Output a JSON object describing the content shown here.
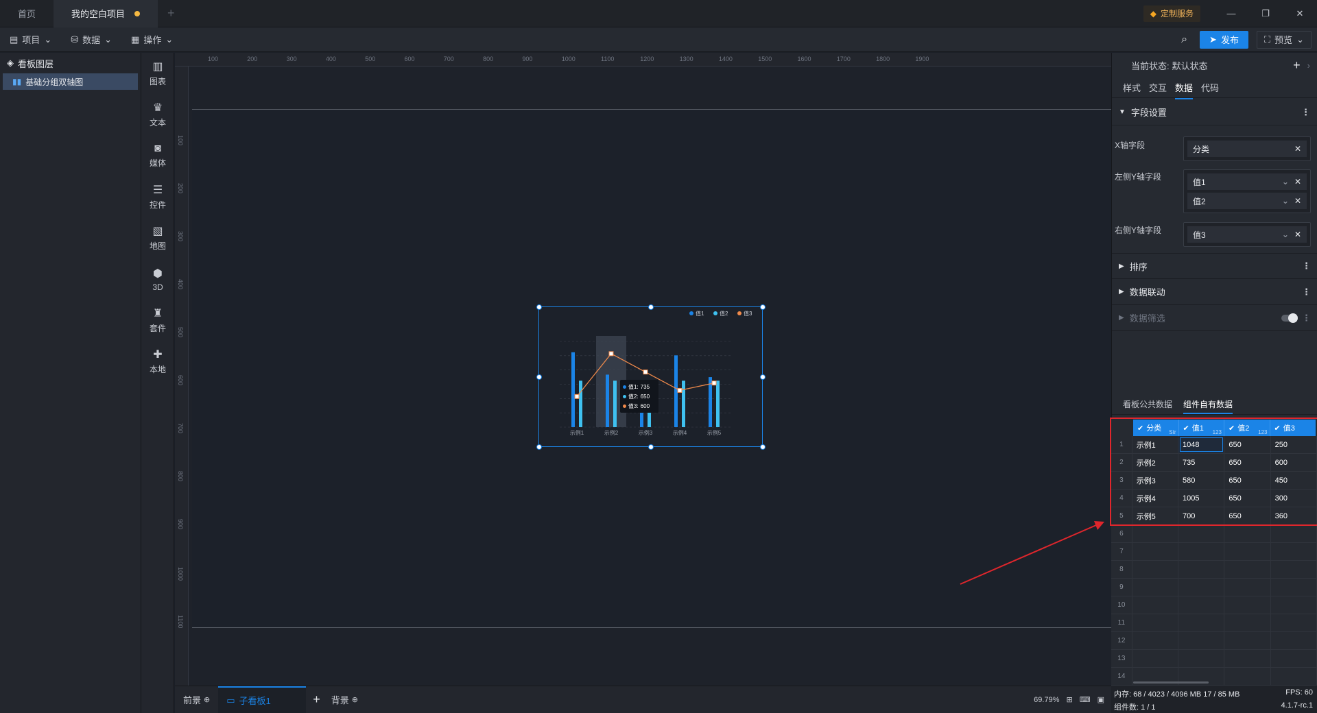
{
  "tabs": {
    "home": "首页",
    "project": "我的空白项目"
  },
  "custom_service": "定制服务",
  "toolbar": {
    "project": "项目",
    "data": "数据",
    "operate": "操作",
    "publish": "发布",
    "preview": "预览"
  },
  "layers": {
    "title": "看板图层",
    "item": "基础分组双轴图"
  },
  "iconbar": [
    "图表",
    "文本",
    "媒体",
    "控件",
    "地图",
    "3D",
    "套件",
    "本地"
  ],
  "ruler_top": [
    "100",
    "200",
    "300",
    "400",
    "500",
    "600",
    "700",
    "800",
    "900",
    "1000",
    "1100",
    "1200",
    "1300",
    "1400",
    "1500",
    "1600",
    "1700",
    "1800",
    "1900"
  ],
  "ruler_left": [
    "100",
    "200",
    "300",
    "400",
    "500",
    "600",
    "700",
    "800",
    "900",
    "1000",
    "1100"
  ],
  "chart": {
    "legend": [
      "值1",
      "值2",
      "值3"
    ],
    "categories": [
      "示例1",
      "示例2",
      "示例3",
      "示例4",
      "示例5"
    ],
    "tooltip": [
      {
        "name": "值1:",
        "value": "735"
      },
      {
        "name": "值2:",
        "value": "650"
      },
      {
        "name": "值3:",
        "value": "600"
      }
    ]
  },
  "chart_data": {
    "type": "bar",
    "categories": [
      "示例1",
      "示例2",
      "示例3",
      "示例4",
      "示例5"
    ],
    "series": [
      {
        "name": "值1",
        "type": "bar",
        "axis": "left",
        "values": [
          1048,
          735,
          580,
          1005,
          700
        ],
        "color": "#1b84e7"
      },
      {
        "name": "值2",
        "type": "bar",
        "axis": "left",
        "values": [
          650,
          650,
          650,
          650,
          650
        ],
        "color": "#3fc1f0"
      },
      {
        "name": "值3",
        "type": "line",
        "axis": "right",
        "values": [
          250,
          600,
          450,
          300,
          360
        ],
        "color": "#f08a4b"
      }
    ],
    "ylim_left": [
      0,
      1200
    ],
    "ylim_right": [
      0,
      700
    ],
    "legend_position": "top-right",
    "grid": true,
    "highlight_category": "示例2"
  },
  "bottom": {
    "front": "前景",
    "sub": "子看板1",
    "back": "背景",
    "zoom": "69.79%"
  },
  "panel": {
    "state_label": "当前状态:",
    "state_value": "默认状态",
    "tabs": [
      "样式",
      "交互",
      "数据",
      "代码"
    ],
    "field_settings": "字段设置",
    "x_field_label": "X轴字段",
    "x_field": "分类",
    "left_y_label": "左侧Y轴字段",
    "left_y": [
      "值1",
      "值2"
    ],
    "right_y_label": "右侧Y轴字段",
    "right_y": "值3",
    "sort": "排序",
    "linkage": "数据联动",
    "filter": "数据筛选",
    "data_tabs": [
      "看板公共数据",
      "组件自有数据"
    ]
  },
  "table": {
    "headers": [
      {
        "name": "分类",
        "type": "Str"
      },
      {
        "name": "值1",
        "type": "123"
      },
      {
        "name": "值2",
        "type": "123"
      },
      {
        "name": "值3",
        "type": "123"
      }
    ],
    "rows": [
      [
        "示例1",
        "1048",
        "650",
        "250"
      ],
      [
        "示例2",
        "735",
        "650",
        "600"
      ],
      [
        "示例3",
        "580",
        "650",
        "450"
      ],
      [
        "示例4",
        "1005",
        "650",
        "300"
      ],
      [
        "示例5",
        "700",
        "650",
        "360"
      ]
    ],
    "row_numbers": [
      "1",
      "2",
      "3",
      "4",
      "5",
      "6",
      "7",
      "8",
      "9",
      "10",
      "11",
      "12",
      "13",
      "14"
    ]
  },
  "status": {
    "memory": "内存: 68 / 4023 / 4096 MB  17 / 85 MB",
    "fps": "FPS: 60",
    "components": "组件数: 1 / 1",
    "version": "4.1.7-rc.1"
  }
}
